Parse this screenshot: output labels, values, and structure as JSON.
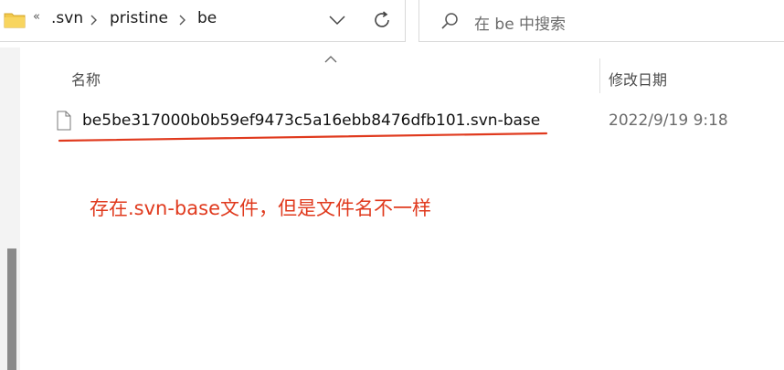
{
  "address_bar": {
    "overflow_chevron": "«",
    "breadcrumb": [
      ".svn",
      "pristine",
      "be"
    ],
    "icons": [
      "folder-icon",
      "chevron-right-icon",
      "chevron-down-icon",
      "refresh-icon"
    ]
  },
  "search": {
    "placeholder": "在 be 中搜索",
    "icon": "search-icon"
  },
  "columns": {
    "name": "名称",
    "date_modified": "修改日期"
  },
  "files": [
    {
      "name": "be5be317000b0b59ef9473c5a16ebb8476dfb101.svn-base",
      "date": "2022/9/19 9:18",
      "icon": "file-icon"
    }
  ],
  "annotation": {
    "text": "存在.svn-base文件，但是文件名不一样",
    "color": "#e03a1e"
  },
  "colors": {
    "accent_annotation": "#e03a1e",
    "scrollbar": "#8b8b8b",
    "folder_yellow": "#f2c94c"
  }
}
